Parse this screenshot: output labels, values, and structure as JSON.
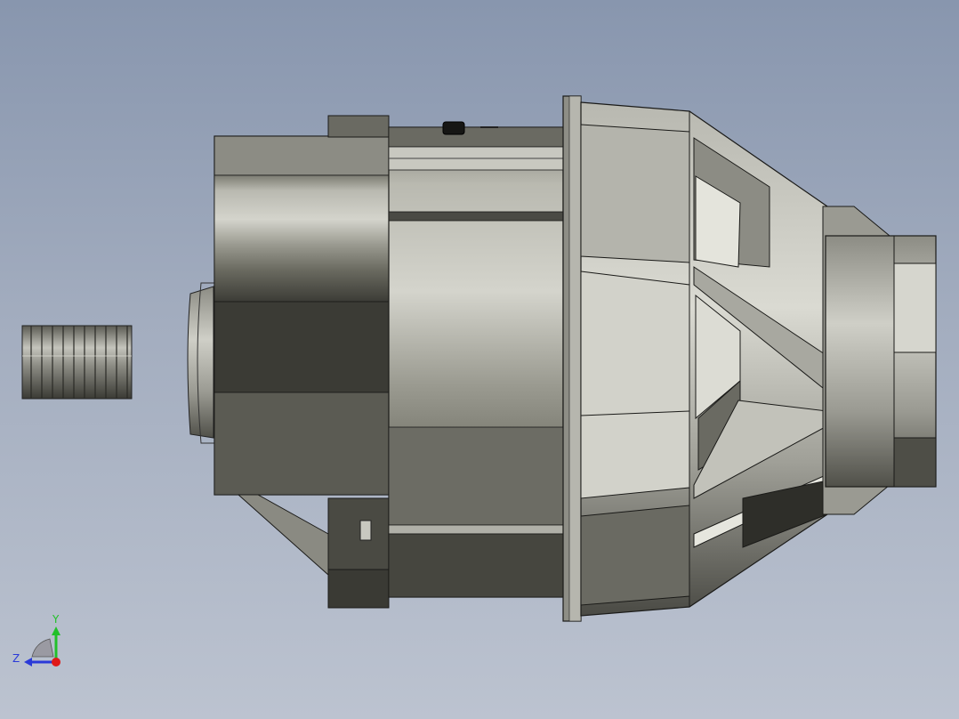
{
  "viewport": {
    "background_top": "#8896ae",
    "background_bottom": "#bcc3d0"
  },
  "model": {
    "shading": "shaded-with-edges",
    "body_color": "#9a9a90",
    "dark_color": "#3a3a34",
    "light_color": "#d6d6ce",
    "edge_color": "#1a1a18"
  },
  "triad": {
    "y_label": "Y",
    "z_label": "Z",
    "y_color": "#22c02a",
    "z_color": "#2a3ad8",
    "x_color": "#e01818"
  }
}
